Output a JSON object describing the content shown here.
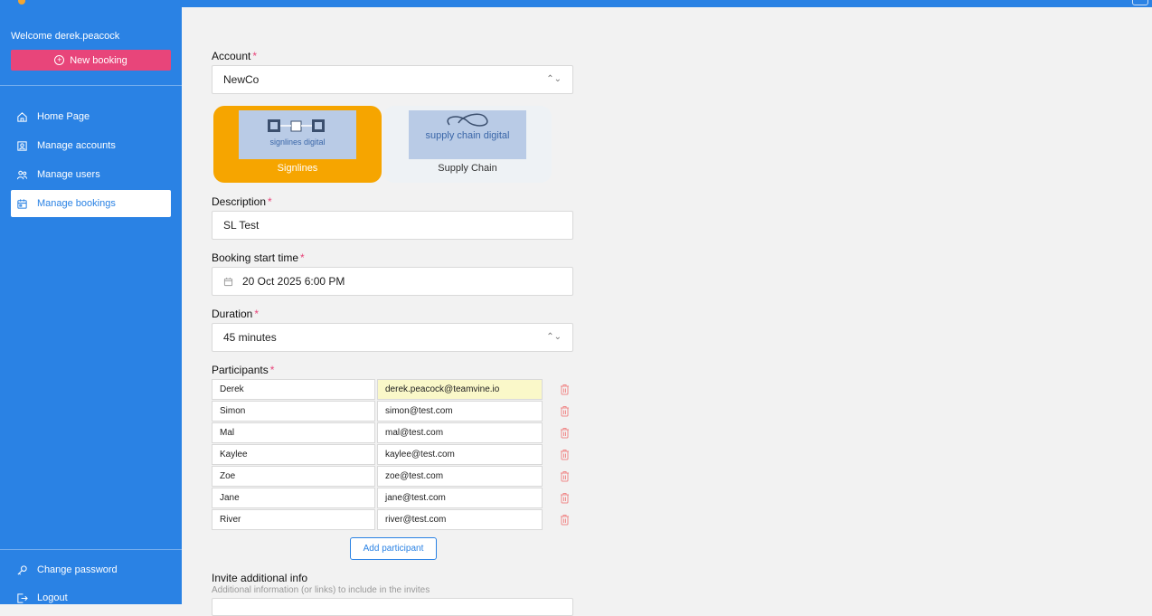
{
  "sidebar": {
    "welcome": "Welcome derek.peacock",
    "new_booking": "New booking",
    "items": [
      {
        "label": "Home Page",
        "icon": "home-icon"
      },
      {
        "label": "Manage accounts",
        "icon": "accounts-icon"
      },
      {
        "label": "Manage users",
        "icon": "users-icon"
      },
      {
        "label": "Manage bookings",
        "icon": "calendar-icon",
        "active": true
      }
    ],
    "footer": [
      {
        "label": "Change password",
        "icon": "key-icon"
      },
      {
        "label": "Logout",
        "icon": "logout-icon"
      }
    ]
  },
  "form": {
    "account": {
      "label": "Account",
      "value": "NewCo"
    },
    "brands": [
      {
        "caption": "Signlines",
        "logo_text": "signlines digital",
        "selected": true
      },
      {
        "caption": "Supply Chain",
        "logo_text": "supply chain digital",
        "selected": false
      }
    ],
    "description": {
      "label": "Description",
      "value": "SL Test"
    },
    "start_time": {
      "label": "Booking start time",
      "value": "20 Oct 2025 6:00 PM"
    },
    "duration": {
      "label": "Duration",
      "value": "45 minutes"
    },
    "participants": {
      "label": "Participants",
      "rows": [
        {
          "name": "Derek",
          "email": "derek.peacock@teamvine.io"
        },
        {
          "name": "Simon",
          "email": "simon@test.com"
        },
        {
          "name": "Mal",
          "email": "mal@test.com"
        },
        {
          "name": "Kaylee",
          "email": "kaylee@test.com"
        },
        {
          "name": "Zoe",
          "email": "zoe@test.com"
        },
        {
          "name": "Jane",
          "email": "jane@test.com"
        },
        {
          "name": "River",
          "email": "river@test.com"
        }
      ],
      "add_label": "Add participant"
    },
    "invite": {
      "label": "Invite additional info",
      "hint": "Additional information (or links) to include in the invites"
    }
  },
  "colors": {
    "primary": "#2a82e4",
    "accent": "#e8457a",
    "selected_tile": "#f6a500",
    "autofill": "#faf8c9"
  }
}
